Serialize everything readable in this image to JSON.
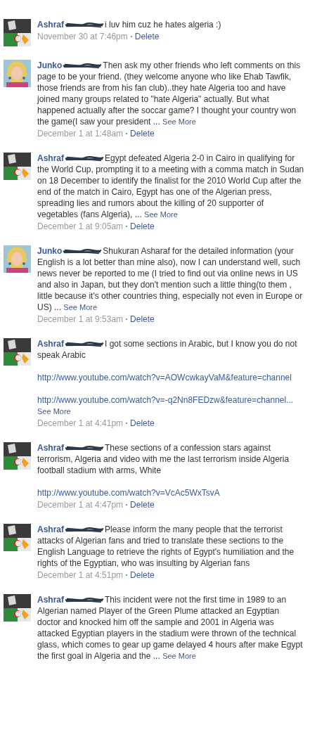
{
  "comments": [
    {
      "author": "Ashraf",
      "redacted": true,
      "body": [
        {
          "kind": "text",
          "text": "i luv him cuz he hates algeria :)"
        }
      ],
      "time": "November 30 at 7:46pm",
      "action": "Delete"
    },
    {
      "author": "Junko",
      "redacted": true,
      "body": [
        {
          "kind": "text",
          "text": "Then ask my other friends who left comments on this page to be your friend. (they welcome anyone who like Ehab Tawfik, those friends are from his fan club)..they hate Algeria too and have joined many groups related to \"hate Algeria\" actually. But what happened actually after the soccar game? I thought your country won the game(I saw your president ..."
        }
      ],
      "see_more": "See More",
      "time": "December 1 at 1:48am",
      "action": "Delete"
    },
    {
      "author": "Ashraf",
      "redacted": true,
      "body": [
        {
          "kind": "text",
          "text": "Egypt defeated Algeria 2-0 in Cairo in qualifying for the World Cup, prompting it to a meeting with a comma match in Sudan on 18 December to identify the finalist for the 2010 World Cup after the end of the match in Cairo, Egypt has one of the Algerian press, spreading lies and rumors about the killing of 20 supporter of vegetables (fans Algeria), ..."
        }
      ],
      "see_more": "See More",
      "time": "December 1 at 9:05am",
      "action": "Delete"
    },
    {
      "author": "Junko",
      "redacted": true,
      "body": [
        {
          "kind": "text",
          "text": "Shukuran Asharaf for the detailed information (your English is a lot better than mine also), now I can understand well, such news never be reported to me (I tried to find out via online news in US and also in Japan, but they don't mention such a little thing(to them , little because it's other countries thing, especially not even in Europe or US) ..."
        }
      ],
      "see_more": "See More",
      "time": "December 1 at 9:53am",
      "action": "Delete"
    },
    {
      "author": "Ashraf",
      "redacted": true,
      "body": [
        {
          "kind": "text",
          "text": "I got some sections in Arabic, but I know you do not speak Arabic"
        },
        {
          "kind": "link",
          "text": "http://www.youtube.com/watch?v=AOWcwkayVaM&feature=channel"
        },
        {
          "kind": "link",
          "text": "http://www.youtube.com/watch?v=-q2Nn8FEDzw&feature=channel..."
        }
      ],
      "see_more": "See More",
      "time": "December 1 at 4:41pm",
      "action": "Delete"
    },
    {
      "author": "Ashraf",
      "redacted": true,
      "body": [
        {
          "kind": "text",
          "text": "These sections of a confession stars against terrorism, Algeria and video with me the last terrorism inside Algeria football stadium with arms, White"
        },
        {
          "kind": "link",
          "text": "http://www.youtube.com/watch?v=VcAc5WxTsvA"
        }
      ],
      "time": "December 1 at 4:47pm",
      "action": "Delete"
    },
    {
      "author": "Ashraf",
      "redacted": true,
      "body": [
        {
          "kind": "text",
          "text": "Please inform the many people that the terrorist attacks of Algerian fans and tried to translate these sections to the English Language to retrieve the rights of Egypt's humiliation and the rights of the Egyptian, who was insulting by Algerian fans"
        }
      ],
      "time": "December 1 at 4:51pm",
      "action": "Delete"
    },
    {
      "author": "Ashraf",
      "redacted": true,
      "body": [
        {
          "kind": "text",
          "text": "This incident were not the first time in 1989 to an Algerian named Player of the Green Plume attacked an Egyptian doctor and knocked him off the sample and 2001 in Algeria was attacked Egyptian players in the stadium were thrown of the technical glass, which comes to gear up game delayed 4 hours after make Egypt the first goal in Algeria and the ..."
        }
      ],
      "see_more": "See More"
    }
  ]
}
